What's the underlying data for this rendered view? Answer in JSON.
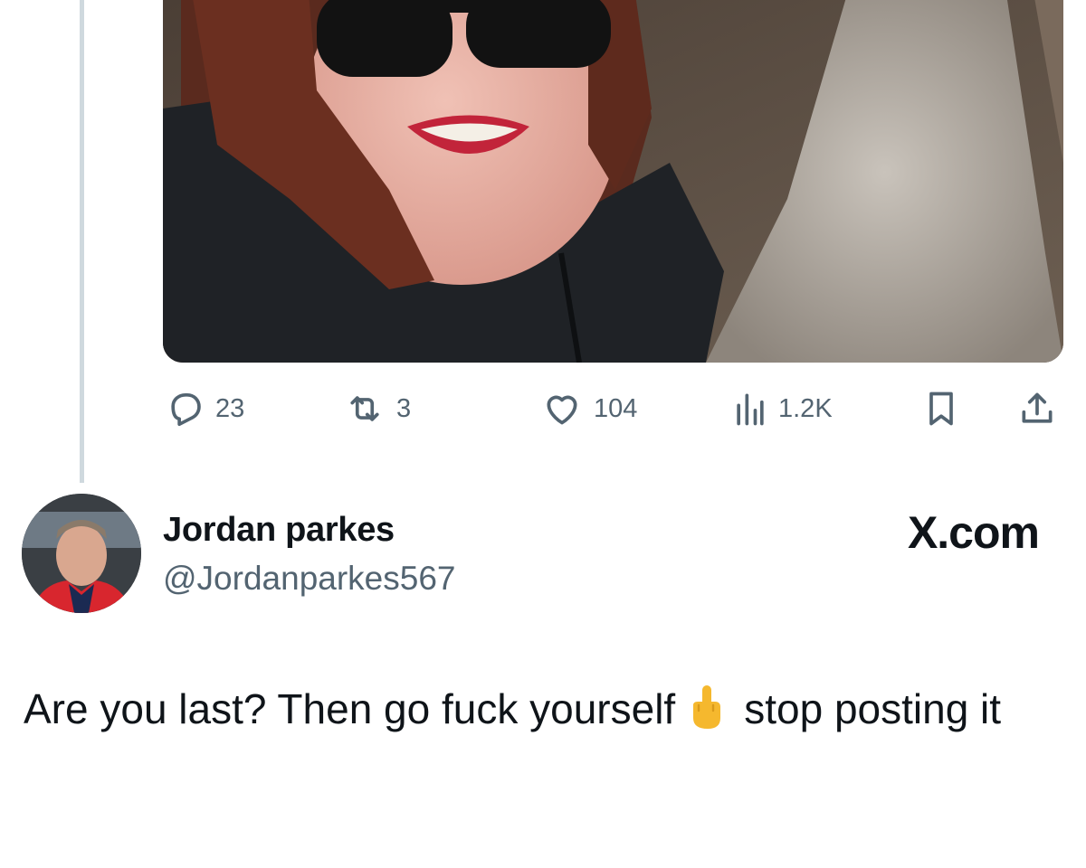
{
  "tweet": {
    "actions": {
      "replies": "23",
      "reposts": "3",
      "likes": "104",
      "views": "1.2K"
    }
  },
  "quote": {
    "author_name": "Jordan parkes",
    "author_handle": "@Jordanparkes567",
    "brand": "X.com",
    "text_part1": "Are you last? Then go fuck yourself",
    "emoji": "middle-finger-emoji",
    "text_part2": "stop posting it"
  },
  "icons": {
    "reply": "reply-icon",
    "repost": "repost-icon",
    "like": "heart-icon",
    "views": "views-icon",
    "bookmark": "bookmark-icon",
    "share": "share-icon"
  },
  "colors": {
    "text_primary": "#0f1419",
    "text_secondary": "#536471",
    "thread_line": "#cfd9de",
    "background": "#ffffff"
  }
}
